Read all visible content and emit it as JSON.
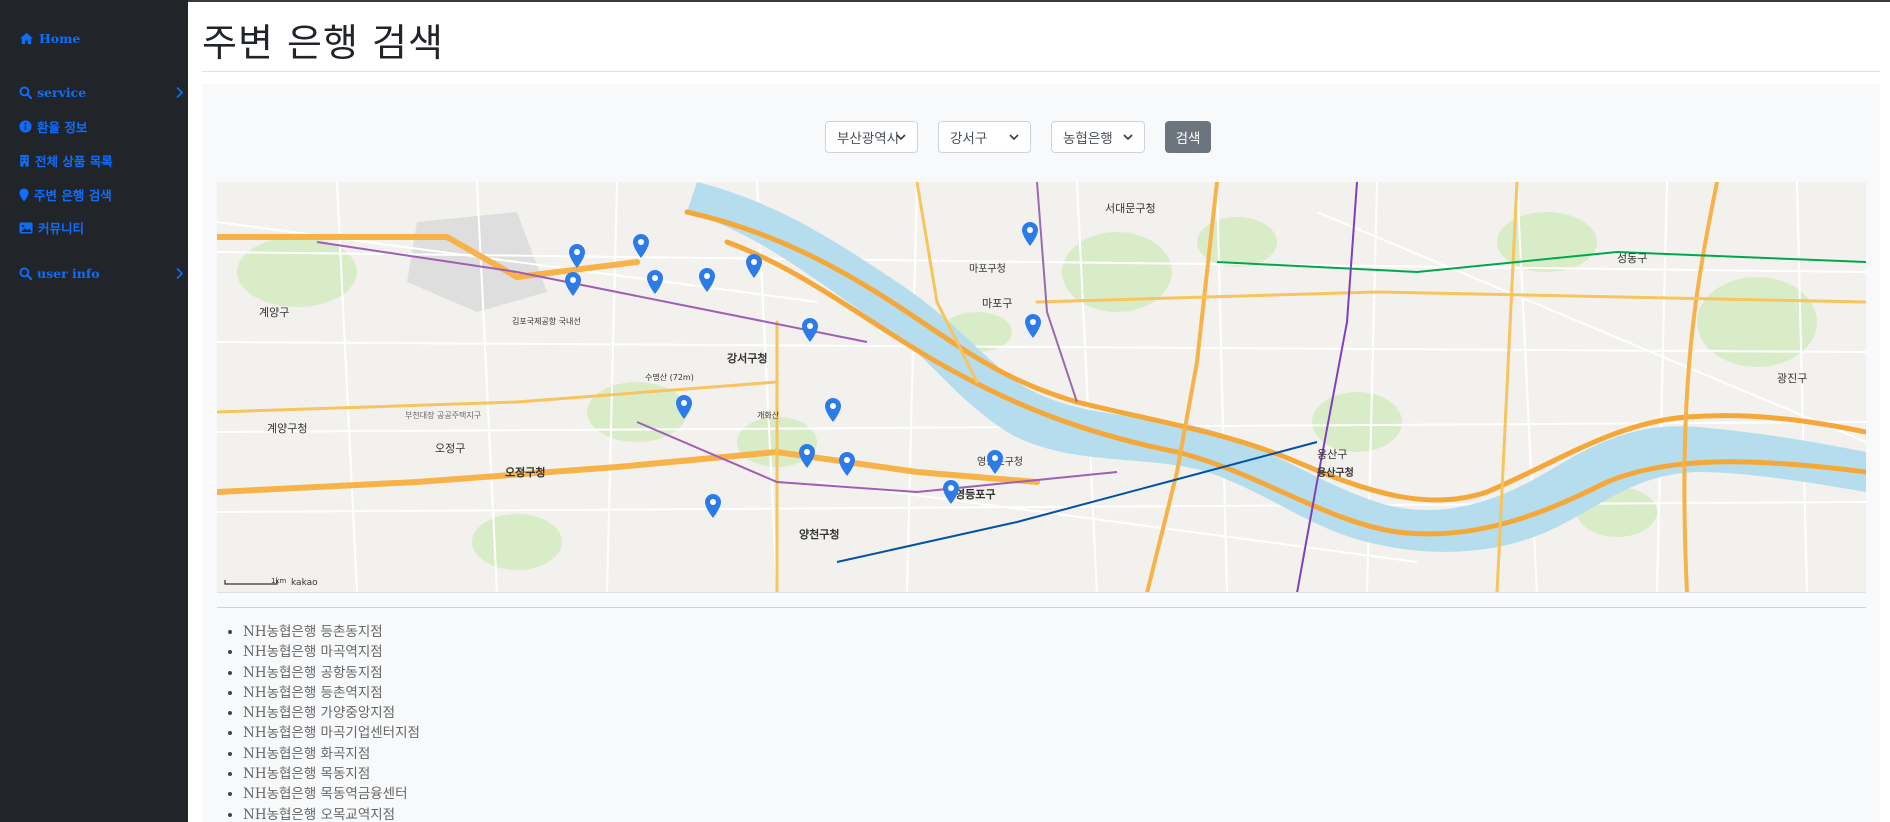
{
  "sidebar": {
    "items": [
      {
        "label": "Home",
        "icon": "home-icon"
      },
      {
        "label": "service",
        "icon": "search-icon",
        "expandable": true
      },
      {
        "label": "환율 정보",
        "icon": "info-icon"
      },
      {
        "label": "전체 상품 목록",
        "icon": "building-icon"
      },
      {
        "label": "주변 은행 검색",
        "icon": "map-pin-icon"
      },
      {
        "label": "커뮤니티",
        "icon": "image-icon"
      },
      {
        "label": "user info",
        "icon": "search-icon",
        "expandable": true
      }
    ]
  },
  "page": {
    "title": "주변 은행 검색"
  },
  "filters": {
    "city": "부산광역시",
    "district": "강서구",
    "bank": "농협은행",
    "search_label": "검색"
  },
  "map": {
    "scale_label": "1km",
    "brand": "kakao",
    "labels": [
      "계양구",
      "계양구청",
      "김포국제공항 국내선",
      "강서구청",
      "마포구",
      "마포구청",
      "서대문구청",
      "영등포구",
      "영등포구청",
      "양천구청",
      "용산구",
      "용산구청",
      "성동구",
      "광진구",
      "오정구청",
      "오정구",
      "부천대장 공공주택지구",
      "수명산 (72m)",
      "개화산"
    ],
    "accent_color": "#2b7ce8"
  },
  "results": [
    "NH농협은행 등촌동지점",
    "NH농협은행 마곡역지점",
    "NH농협은행 공항동지점",
    "NH농협은행 등촌역지점",
    "NH농협은행 가양중앙지점",
    "NH농협은행 마곡기업센터지점",
    "NH농협은행 화곡지점",
    "NH농협은행 목동지점",
    "NH농협은행 목동역금융센터",
    "NH농협은행 오목교역지점"
  ]
}
